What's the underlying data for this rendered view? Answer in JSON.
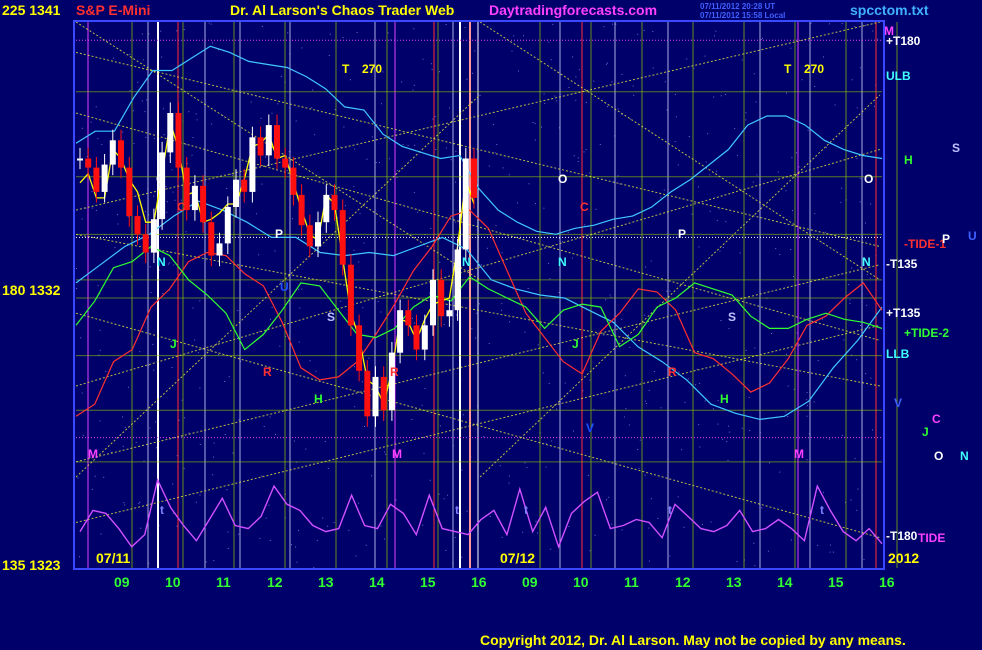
{
  "header": {
    "price_top": "225  1341",
    "instrument": "S&P E-Mini",
    "title": "Dr. Al Larson's Chaos Trader Web",
    "site": "Daytradingforecasts.com",
    "stamp1": "07/11/2012 20:28 UT",
    "stamp2": "07/11/2012 15:58 Local",
    "file": "spcctom.txt"
  },
  "left_axis": {
    "mid": "180  1332",
    "bottom": "135  1323"
  },
  "dates": {
    "d1": "07/11",
    "d2": "07/12",
    "year": "2012"
  },
  "copyright": "Copyright 2012, Dr. Al Larson. May not be copied by any means.",
  "colors": {
    "bg": "#00006a",
    "grid": "#8fc800",
    "up": "#ffffff",
    "down": "#ff1010",
    "ma": "#ffff00",
    "band": "#40c8ff",
    "tide": "#ff3030",
    "osc": "#d050ff",
    "green": "#30ff30"
  },
  "chart_data": {
    "type": "candlestick-with-overlays",
    "title": "S&P E-Mini",
    "y_axis": {
      "label_top": "1341",
      "label_mid": "1332",
      "label_bottom": "1323",
      "angle_top": "225",
      "angle_mid": "180",
      "angle_bottom": "135",
      "ylim": [
        1323,
        1341
      ]
    },
    "x_hour_labels": [
      "09",
      "10",
      "11",
      "12",
      "13",
      "14",
      "15",
      "16",
      "09",
      "10",
      "11",
      "12",
      "13",
      "14",
      "15",
      "16"
    ],
    "series": [
      {
        "name": "price",
        "values": [
          1336.5,
          1336.2,
          1335.4,
          1336.3,
          1337.1,
          1336.2,
          1334.6,
          1334.0,
          1333.4,
          1334.5,
          1336.7,
          1338.0,
          1336.2,
          1334.8,
          1335.6,
          1334.4,
          1333.3,
          1333.7,
          1334.9,
          1335.8,
          1335.4,
          1337.2,
          1336.6,
          1337.6,
          1336.5,
          1336.2,
          1335.3,
          1334.3,
          1333.6,
          1334.4,
          1335.3,
          1334.8,
          1333.0,
          1331.0,
          1329.5,
          1328.0,
          1329.3,
          1328.2,
          1330.1,
          1331.5,
          1331.0,
          1330.2,
          1331.0,
          1332.5,
          1331.3,
          1331.5,
          1333.5,
          1336.5,
          1335.2
        ]
      },
      {
        "name": "C",
        "values": [
          1335.7,
          1336.0,
          1335.2,
          1335.2,
          1336.8,
          1336.5,
          1335.8,
          1335.4,
          1334.4,
          1334.4,
          1336.0,
          1337.7,
          1336.8,
          1335.3,
          1335.4,
          1334.4,
          1334.5,
          1334.7,
          1335.0,
          1335.0,
          1335.8,
          1336.9,
          1337.0,
          1337.3,
          1336.5,
          1336.6,
          1335.7,
          1334.8,
          1334.0,
          1333.8,
          1335.3,
          1335.0,
          1333.2,
          1331.4,
          1330.6,
          1329.2,
          1329.0,
          1328.4,
          1329.5,
          1331.2,
          1331.1,
          1330.5,
          1331.2,
          1331.7,
          1331.8,
          1331.9,
          1333.6,
          1335.8,
          1335.0
        ]
      },
      {
        "name": "ULB",
        "values": [
          1337,
          1337.4,
          1337.4,
          1338.5,
          1339.4,
          1339.4,
          1339.8,
          1340.2,
          1340,
          1339.7,
          1339.6,
          1339.5,
          1339.2,
          1338.8,
          1338.2,
          1338.1,
          1337.3,
          1336.9,
          1336.7,
          1336.5,
          1336.6,
          1335.5,
          1334.8,
          1334.4,
          1334.1,
          1334,
          1334.2,
          1334.3,
          1334.5,
          1334.6,
          1334.9,
          1335.4,
          1335.8,
          1336.3,
          1336.8,
          1337.6,
          1337.9,
          1337.9,
          1337.6,
          1337.1,
          1336.8,
          1336.6,
          1336.5
        ]
      },
      {
        "name": "LLB",
        "values": [
          1332.4,
          1333,
          1333.6,
          1334,
          1334.6,
          1335.1,
          1334.8,
          1334.4,
          1333.9,
          1333.9,
          1333.4,
          1333.3,
          1333.4,
          1333.3,
          1333.6,
          1333.9,
          1333.5,
          1332.5,
          1332.2,
          1332,
          1331.9,
          1331.5,
          1331.1,
          1330.3,
          1329.8,
          1329.2,
          1328.4,
          1328.1,
          1327.9,
          1328,
          1328.5,
          1329.6,
          1330.5,
          1331.6
        ]
      },
      {
        "name": "TIDE",
        "values": [
          1328,
          1328.4,
          1329.8,
          1330.2,
          1331.6,
          1332.2,
          1333.1,
          1333.4,
          1333.3,
          1332.7,
          1332.3,
          1331.1,
          1329.6,
          1329.2,
          1329.3,
          1329.8,
          1330.7,
          1331.7,
          1332.8,
          1333.6,
          1334.6,
          1334.8,
          1334.2,
          1332.8,
          1331.4,
          1330.6,
          1329.8,
          1329.4,
          1330.8,
          1331.4,
          1332.2,
          1332.1,
          1331.5,
          1330.1,
          1329.9,
          1329.4,
          1328.8,
          1329.1,
          1329.9,
          1331,
          1331.3,
          1331.9,
          1332.4,
          1331.5
        ]
      },
      {
        "name": "TIDE-2",
        "values": [
          1331,
          1331.8,
          1332.9,
          1333.1,
          1333.6,
          1333.3,
          1332.5,
          1332,
          1331.4,
          1330.2,
          1330.7,
          1331.5,
          1332.4,
          1332.3,
          1331.5,
          1330.7,
          1330.6,
          1330.9,
          1331.6,
          1332,
          1331.8,
          1332.6,
          1332.2,
          1331.9,
          1331.6,
          1330.9,
          1331.5,
          1331.7,
          1331.6,
          1330.3,
          1330.7,
          1331.6,
          1331.9,
          1332.4,
          1332.2,
          1332,
          1331.3,
          1330.9,
          1330.9,
          1331.2,
          1331.4,
          1331.2,
          1331.1,
          1330.9
        ]
      },
      {
        "name": "osc",
        "values": [
          1324.2,
          1324.9,
          1324.8,
          1324.3,
          1323.7,
          1324.1,
          1325.9,
          1325,
          1324.4,
          1323.9,
          1324.6,
          1325.3,
          1324.4,
          1324.3,
          1324.7,
          1325.7,
          1325.1,
          1324.9,
          1324.4,
          1324.2,
          1324.3,
          1325.4,
          1324.4,
          1324.3,
          1325.1,
          1324.8,
          1324.1,
          1325.4,
          1324.3,
          1324.2,
          1324.1,
          1324.6,
          1324.9,
          1324.1,
          1325.6,
          1324.2,
          1325,
          1323.7,
          1324.8,
          1325.2,
          1325.5,
          1324.3,
          1324.4,
          1324.6,
          1324.5,
          1324,
          1325.1,
          1324.7,
          1324.3,
          1324.2,
          1324.4,
          1324.9,
          1324.2,
          1324.3,
          1324.6,
          1324.3,
          1323.9,
          1325.7,
          1324.9,
          1324.2,
          1323.9,
          1324.3,
          1323.8
        ]
      }
    ],
    "right_labels": [
      "M",
      "+T180",
      "ULB",
      "H",
      "S",
      "-TIDE-1",
      "P",
      "U",
      "-T135",
      "+T135",
      "+TIDE-2",
      "LLB",
      "V",
      "C",
      "J",
      "O",
      "N",
      "-T180",
      "TIDE"
    ],
    "chart_labels": [
      "T",
      "270",
      "T",
      "270",
      "O",
      "O",
      "O",
      "C",
      "C",
      "P",
      "P",
      "N",
      "N",
      "N",
      "N",
      "S",
      "S",
      "U",
      "J",
      "J",
      "R",
      "R",
      "R",
      "H",
      "H",
      "M",
      "M",
      "M",
      "V",
      "t",
      "t",
      "t",
      "t",
      "t"
    ]
  }
}
